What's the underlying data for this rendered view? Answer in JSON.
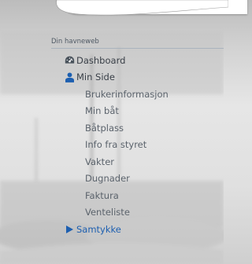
{
  "section": {
    "title": "Din havneweb"
  },
  "menu": {
    "dashboard": {
      "label": "Dashboard",
      "icon": "dashboard-icon"
    },
    "min_side": {
      "label": "Min Side",
      "icon": "user-icon",
      "color": "#1d5fb0"
    },
    "sub_items": [
      {
        "label": "Brukerinformasjon"
      },
      {
        "label": "Min båt"
      },
      {
        "label": "Båtplass"
      },
      {
        "label": "Info fra styret"
      },
      {
        "label": "Vakter"
      },
      {
        "label": "Dugnader"
      },
      {
        "label": "Faktura"
      },
      {
        "label": "Venteliste"
      }
    ],
    "samtykke": {
      "label": "Samtykke",
      "icon": "caret-right-icon",
      "color": "#1d5fb0"
    }
  }
}
